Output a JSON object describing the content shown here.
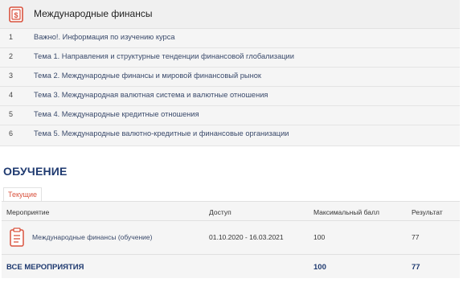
{
  "course": {
    "title": "Международные финансы",
    "topics": [
      {
        "num": "1",
        "text": "Важно!. Информация по изучению курса"
      },
      {
        "num": "2",
        "text": "Тема 1. Направления и структурные тенденции финансовой глобализации"
      },
      {
        "num": "3",
        "text": "Тема 2. Международные финансы и мировой финансовый рынок"
      },
      {
        "num": "4",
        "text": "Тема 3. Международная валютная система и валютные отношения"
      },
      {
        "num": "5",
        "text": "Тема 4. Международные кредитные отношения"
      },
      {
        "num": "6",
        "text": "Тема 5. Международные валютно-кредитные и финансовые организации"
      }
    ]
  },
  "learning": {
    "section_title": "ОБУЧЕНИЕ",
    "tab_current": "Текущие",
    "columns": {
      "event": "Мероприятие",
      "access": "Доступ",
      "max_score": "Максимальный балл",
      "result": "Результат"
    },
    "rows": [
      {
        "event": "Международные финансы (обучение)",
        "access": "01.10.2020 - 16.03.2021",
        "max_score": "100",
        "result": "77"
      }
    ],
    "total": {
      "label": "ВСЕ МЕРОПРИЯТИЯ",
      "max_score": "100",
      "result": "77"
    }
  },
  "colors": {
    "accent_red": "#d9533f",
    "title_blue": "#1f3a70"
  },
  "icons": {
    "course": "course-book-icon",
    "event": "clipboard-icon"
  }
}
